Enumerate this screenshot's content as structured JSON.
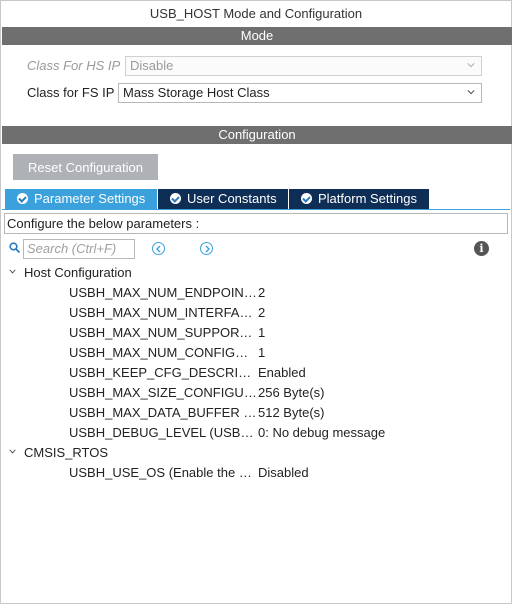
{
  "window": {
    "title": "USB_HOST Mode and Configuration"
  },
  "mode": {
    "header": "Mode",
    "hs_ip": {
      "label": "Class For HS IP",
      "value": "Disable"
    },
    "fs_ip": {
      "label": "Class for FS IP",
      "value": "Mass Storage Host Class"
    }
  },
  "configuration": {
    "header": "Configuration",
    "reset_label": "Reset Configuration",
    "tabs": [
      {
        "label": "Parameter Settings",
        "active": true
      },
      {
        "label": "User Constants",
        "active": false
      },
      {
        "label": "Platform Settings",
        "active": false
      }
    ],
    "description": "Configure the below parameters :",
    "search_placeholder": "Search (Ctrl+F)",
    "groups": [
      {
        "name": "Host Configuration",
        "params": [
          {
            "name": "USBH_MAX_NUM_ENDPOINTS",
            "value": "2"
          },
          {
            "name": "USBH_MAX_NUM_INTERFACES",
            "value": "2"
          },
          {
            "name": "USBH_MAX_NUM_SUPPORTED_CLASS",
            "value": "1"
          },
          {
            "name": "USBH_MAX_NUM_CONFIGURATION",
            "value": "1"
          },
          {
            "name": "USBH_KEEP_CFG_DESCRIPTOR",
            "value": "Enabled"
          },
          {
            "name": "USBH_MAX_SIZE_CONFIGURATION",
            "value": "256 Byte(s)"
          },
          {
            "name": "USBH_MAX_DATA_BUFFER (Max Data Buffer Size)",
            "value": "512 Byte(s)"
          },
          {
            "name": "USBH_DEBUG_LEVEL (USBH Debug Level)",
            "value": "0: No debug message"
          }
        ]
      },
      {
        "name": "CMSIS_RTOS",
        "params": [
          {
            "name": "USBH_USE_OS (Enable the support of an RTOS)",
            "value": "Disabled"
          }
        ]
      }
    ]
  },
  "colors": {
    "accent": "#3ba1dc",
    "tab_inactive": "#0f2e56",
    "section_bar": "#6f6f6f",
    "button": "#aeb2b6"
  },
  "icons": [
    "check-circle-icon",
    "search-icon",
    "chevron-left-icon",
    "chevron-right-icon",
    "info-icon",
    "chevron-down-icon"
  ]
}
